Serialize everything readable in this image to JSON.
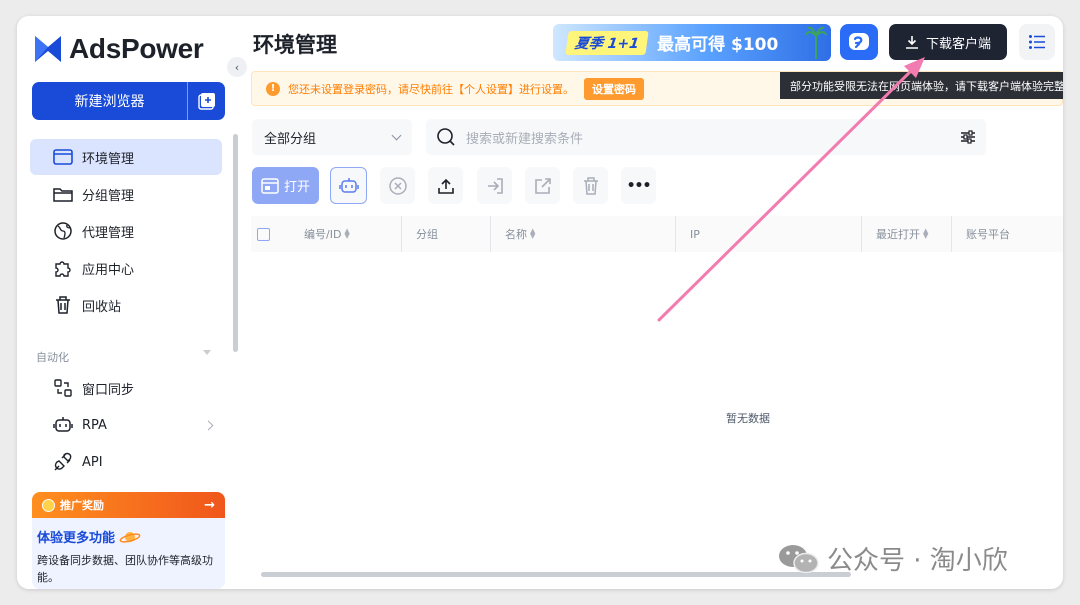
{
  "app": {
    "name": "AdsPower"
  },
  "sidebar": {
    "new_browser_label": "新建浏览器",
    "nav": [
      {
        "label": "环境管理",
        "icon": "browser-window-icon",
        "active": true
      },
      {
        "label": "分组管理",
        "icon": "folder-icon",
        "active": false
      },
      {
        "label": "代理管理",
        "icon": "globe-icon",
        "active": false
      },
      {
        "label": "应用中心",
        "icon": "puzzle-icon",
        "active": false
      },
      {
        "label": "回收站",
        "icon": "trash-icon",
        "active": false
      }
    ],
    "automation_label": "自动化",
    "automation_items": [
      {
        "label": "窗口同步",
        "icon": "sync-windows-icon"
      },
      {
        "label": "RPA",
        "icon": "robot-icon"
      },
      {
        "label": "API",
        "icon": "plug-icon"
      }
    ],
    "promo": {
      "header": "推广奖励",
      "arrow": "→",
      "title": "体验更多功能",
      "desc": "跨设备同步数据、团队协作等高级功能。"
    }
  },
  "header": {
    "page_title": "环境管理",
    "banner_tag": "夏季 1+1",
    "banner_text": "最高可得 $100",
    "download_label": "下载客户端",
    "tooltip": "部分功能受限无法在网页端体验，请下载客户端体验完整功能"
  },
  "notice": {
    "text": "您还未设置登录密码，请尽快前往【个人设置】进行设置。",
    "button": "设置密码"
  },
  "filters": {
    "group_value": "全部分组",
    "search_placeholder": "搜索或新建搜索条件"
  },
  "toolbar": {
    "open_label": "打开",
    "more_label": "•••"
  },
  "table": {
    "columns": [
      "编号/ID",
      "分组",
      "名称",
      "IP",
      "最近打开",
      "账号平台"
    ],
    "empty_text": "暂无数据"
  },
  "watermark": {
    "text": "公众号 · 淘小欣"
  },
  "colors": {
    "primary": "#1a4bd8",
    "warning": "#ff7d00",
    "arrow": "#f27bb0"
  }
}
